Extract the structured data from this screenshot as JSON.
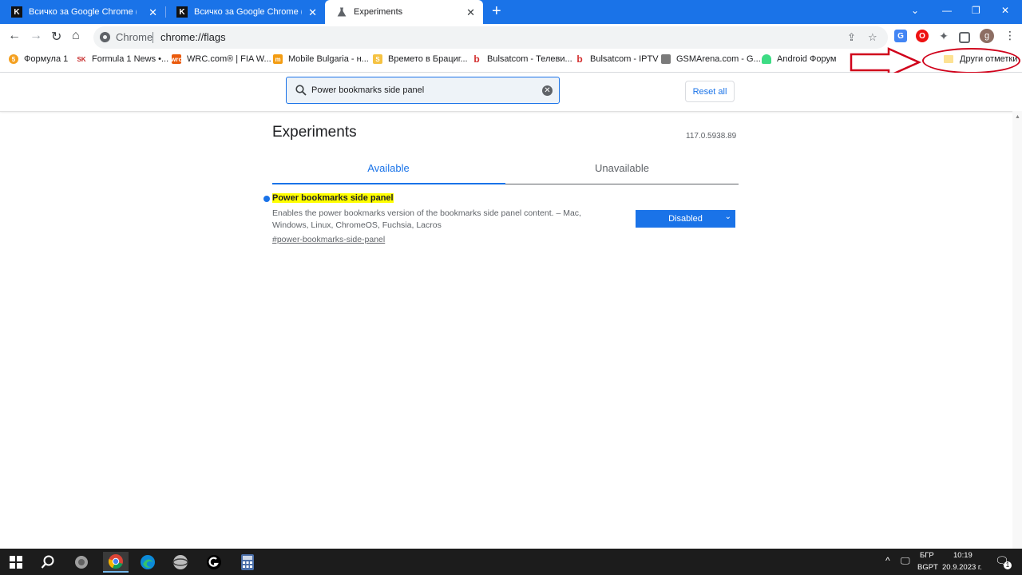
{
  "tabs": [
    {
      "title": "Всичко за Google Chrome (обе...",
      "favicon": "K"
    },
    {
      "title": "Всичко за Google Chrome (обе...",
      "favicon": "K"
    },
    {
      "title": "Experiments",
      "favicon": "flask-icon"
    }
  ],
  "window": {
    "minimize": "—",
    "maximize": "❐",
    "close": "✕"
  },
  "omnibox": {
    "chip": "Chrome",
    "url": "chrome://flags"
  },
  "avatar_letter": "g",
  "bookmarks": [
    {
      "label": "Формула 1",
      "color": "#f4a020"
    },
    {
      "label": "Formula 1 News •...",
      "color": "#c62828"
    },
    {
      "label": "WRC.com® | FIA W...",
      "color": "#ea5a0c"
    },
    {
      "label": "Mobile Bulgaria - н...",
      "color": "#f39c12"
    },
    {
      "label": "Времето в Брациг...",
      "color": "#f5c242"
    },
    {
      "label": "Bulsatcom - Телеви...",
      "color": "#d32f2f"
    },
    {
      "label": "Bulsatcom - IPTV",
      "color": "#d32f2f"
    },
    {
      "label": "GSMArena.com - G...",
      "color": "#7a7a7a"
    },
    {
      "label": "Android Форум",
      "color": "#3ddc84"
    }
  ],
  "other_bookmarks": "Други отметки",
  "search": {
    "value": "Power bookmarks side panel"
  },
  "reset_all": "Reset all",
  "title": "Experiments",
  "version": "117.0.5938.89",
  "tab_available": "Available",
  "tab_unavailable": "Unavailable",
  "experiment": {
    "name": "Power bookmarks side panel",
    "description": "Enables the power bookmarks version of the bookmarks side panel content. – Mac, Windows, Linux, ChromeOS, Fuchsia, Lacros",
    "link": "#power-bookmarks-side-panel",
    "state": "Disabled"
  },
  "taskbar": {
    "lang_top": "БГР",
    "lang_bottom": "BGPT",
    "time": "10:19",
    "date": "20.9.2023 г.",
    "notifications": "1"
  },
  "colors": {
    "accent": "#1a73e8",
    "annotation": "#d0021b",
    "highlight": "#ffff00"
  }
}
